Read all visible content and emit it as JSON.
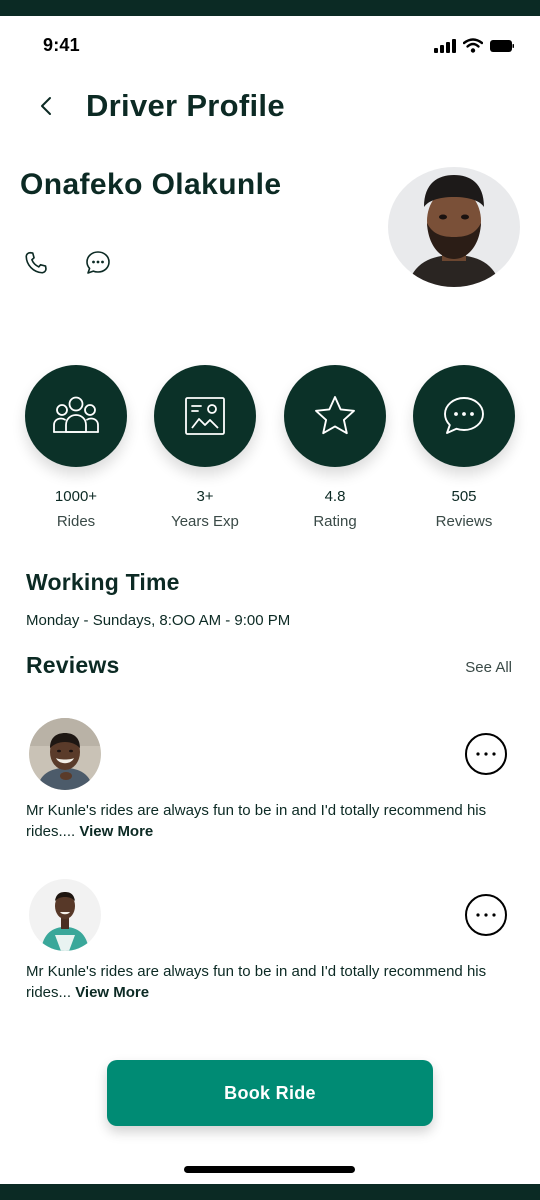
{
  "status_bar": {
    "time": "9:41"
  },
  "header": {
    "title": "Driver Profile"
  },
  "driver": {
    "name": "Onafeko Olakunle"
  },
  "stats": [
    {
      "value": "1000+",
      "label": "Rides",
      "icon": "users-icon"
    },
    {
      "value": "3+",
      "label": "Years Exp",
      "icon": "certificate-icon"
    },
    {
      "value": "4.8",
      "label": "Rating",
      "icon": "star-icon"
    },
    {
      "value": "505",
      "label": "Reviews",
      "icon": "chat-icon"
    }
  ],
  "working_time": {
    "title": "Working Time",
    "text": "Monday - Sundays, 8:OO AM - 9:00 PM"
  },
  "reviews": {
    "title": "Reviews",
    "see_all": "See All",
    "items": [
      {
        "text": "Mr Kunle's rides are always fun to be in and I'd totally recommend his rides....",
        "view_more": "View More"
      },
      {
        "text": "Mr Kunle's rides are always fun to be in and I'd totally recommend his rides...",
        "view_more": "View More"
      }
    ]
  },
  "book_button": {
    "label": "Book Ride"
  },
  "colors": {
    "dark_green": "#0b3128",
    "accent": "#008b74",
    "text": "#0c2a24"
  }
}
